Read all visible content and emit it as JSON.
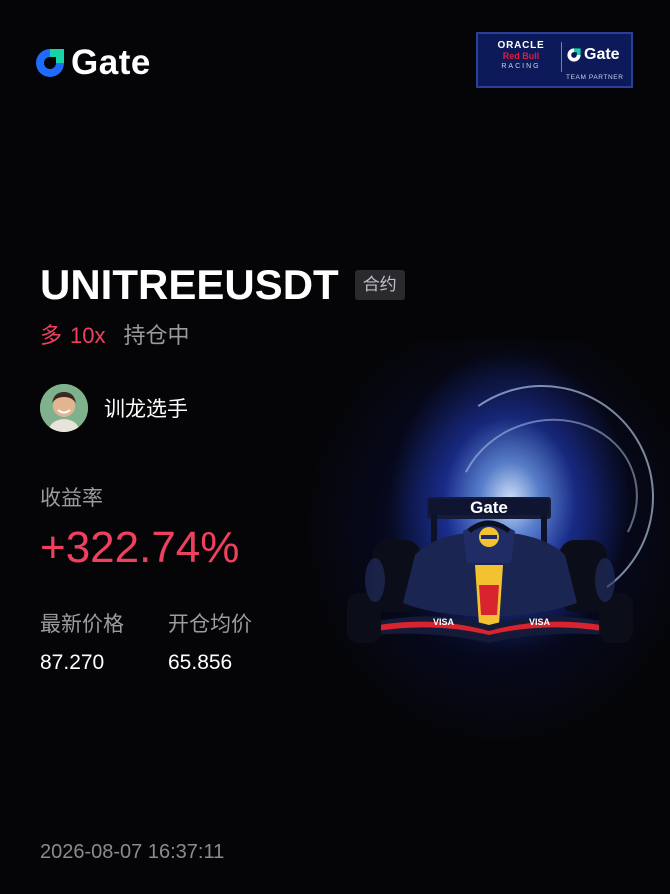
{
  "brand": {
    "name": "Gate",
    "accent": "#1f6bff"
  },
  "partner": {
    "oracle": "ORACLE",
    "redbull": "Red Bull",
    "racing": "RACING",
    "gate": "Gate",
    "caption": "TEAM PARTNER"
  },
  "position": {
    "symbol": "UNITREEUSDT",
    "type_badge": "合约",
    "side": "多",
    "leverage": "10x",
    "status": "持仓中"
  },
  "user": {
    "name": "训龙选手"
  },
  "roi": {
    "label": "收益率",
    "value": "+322.74%"
  },
  "prices": {
    "latest_label": "最新价格",
    "latest_value": "87.270",
    "entry_label": "开仓均价",
    "entry_value": "65.856"
  },
  "timestamp": "2026-08-07 16:37:11",
  "car": {
    "wing_text": "Gate",
    "side_text": "VISA"
  },
  "colors": {
    "profit": "#f0405f",
    "muted": "#9a9aa0",
    "background": "#050507"
  }
}
